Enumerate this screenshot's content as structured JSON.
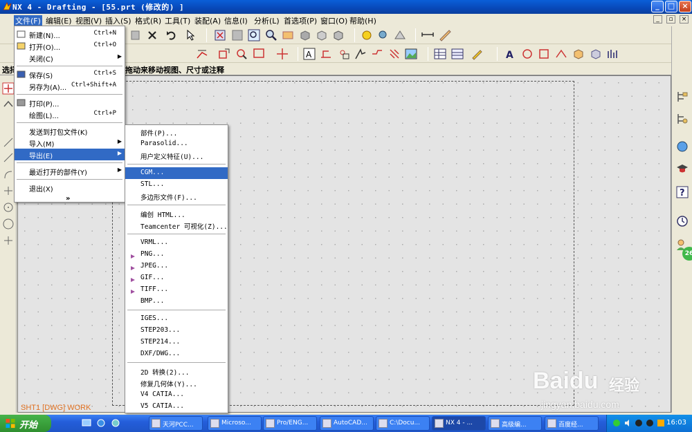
{
  "window": {
    "title": "NX 4 - Drafting - [55.prt (修改的) ]",
    "min": "_",
    "max": "□",
    "close": "×"
  },
  "menubar": [
    "文件(F)",
    "编辑(E)",
    "视图(V)",
    "插入(S)",
    "格式(R)",
    "工具(T)",
    "装配(A)",
    "信息(I)",
    "分析(L)",
    "首选项(P)",
    "窗口(O)",
    "帮助(H)"
  ],
  "cueline": {
    "left": "选择",
    "text": "拖动来移动视图、尺寸或注释"
  },
  "file_menu": [
    {
      "label": "新建(N)...",
      "shortcut": "Ctrl+N",
      "icon": "new-file-icon"
    },
    {
      "label": "打开(O)...",
      "shortcut": "Ctrl+O",
      "icon": "open-folder-icon"
    },
    {
      "label": "关闭(C)",
      "submenu": true
    },
    {
      "sep": true
    },
    {
      "label": "保存(S)",
      "shortcut": "Ctrl+S",
      "icon": "save-icon"
    },
    {
      "label": "另存为(A)...",
      "shortcut": "Ctrl+Shift+A"
    },
    {
      "sep": true
    },
    {
      "label": "打印(P)...",
      "icon": "print-icon"
    },
    {
      "label": "绘图(L)...",
      "shortcut": "Ctrl+P"
    },
    {
      "sep": true
    },
    {
      "label": "发送到打包文件(K)"
    },
    {
      "label": "导入(M)",
      "submenu": true
    },
    {
      "label": "导出(E)",
      "submenu": true,
      "highlight": true
    },
    {
      "sep": true
    },
    {
      "label": "最近打开的部件(Y)",
      "submenu": true
    },
    {
      "sep": true
    },
    {
      "label": "退出(X)"
    },
    {
      "label": "»",
      "expander": true
    }
  ],
  "export_menu": [
    {
      "label": "部件(P)..."
    },
    {
      "label": "Parasolid..."
    },
    {
      "label": "用户定义特征(U)..."
    },
    {
      "sep": true
    },
    {
      "label": "CGM...",
      "highlight": true
    },
    {
      "label": "STL..."
    },
    {
      "label": "多边形文件(F)..."
    },
    {
      "sep": true
    },
    {
      "label": "编创 HTML..."
    },
    {
      "label": "Teamcenter 可视化(Z)..."
    },
    {
      "sep": true
    },
    {
      "label": "VRML..."
    },
    {
      "label": "PNG...",
      "icon": "PNG"
    },
    {
      "label": "JPEG...",
      "icon": "JPEG"
    },
    {
      "label": "GIF...",
      "icon": "GIF"
    },
    {
      "label": "TIFF...",
      "icon": "TIFF"
    },
    {
      "label": "BMP..."
    },
    {
      "sep": true
    },
    {
      "label": "IGES..."
    },
    {
      "label": "STEP203..."
    },
    {
      "label": "STEP214..."
    },
    {
      "label": "DXF/DWG..."
    },
    {
      "sep": true
    },
    {
      "label": "2D 转换(2)..."
    },
    {
      "label": "修复几何体(Y)..."
    },
    {
      "label": "V4 CATIA..."
    },
    {
      "label": "V5 CATIA..."
    }
  ],
  "sheet_label": "SHT1 [DWG] WORK",
  "taskbar": {
    "start": "开始",
    "tasks": [
      "天河PCC...",
      "Microso...",
      "Pro/ENG...",
      "AutoCAD...",
      "C:\\Docu...",
      "NX 4 - ...",
      "高级编...",
      "百度经..."
    ],
    "active_task": 5,
    "clock": "16:03"
  },
  "right_badge": "26",
  "watermark": {
    "brand": "Baidu",
    "cn": "经验",
    "url": "jingyan.baidu.com"
  }
}
